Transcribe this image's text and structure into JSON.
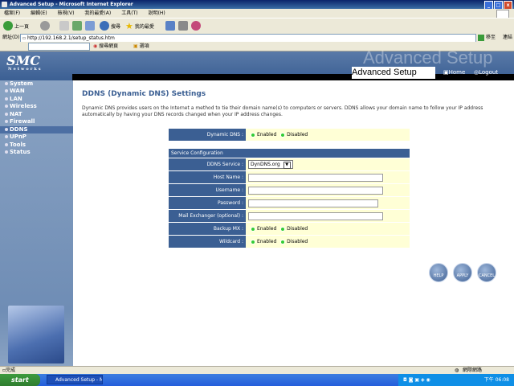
{
  "window": {
    "title": "Advanced Setup - Microsoft Internet Explorer"
  },
  "menu": [
    "檔案(F)",
    "編輯(E)",
    "檢視(V)",
    "我的最愛(A)",
    "工具(T)",
    "說明(H)"
  ],
  "toolbar": {
    "back_label": "上一頁",
    "search_label": "搜尋",
    "favorites_label": "我的最愛"
  },
  "address": {
    "label": "網址(D)",
    "url": "http://192.168.2.1/setup_status.htm",
    "go_label": "移至",
    "links_label": "連結"
  },
  "linkbar": {
    "search_web": "搜尋網頁",
    "options": "選項"
  },
  "brand": {
    "logo": "SMC",
    "logo_sub": "Networks",
    "watermark": "Advanced Setup",
    "section": "Advanced Setup"
  },
  "header_nav": {
    "home": "Home",
    "logout": "Logout"
  },
  "sidebar": {
    "items": [
      "System",
      "WAN",
      "LAN",
      "Wireless",
      "NAT",
      "Firewall",
      "DDNS",
      "UPnP",
      "Tools",
      "Status"
    ],
    "selected": "DDNS"
  },
  "page": {
    "title": "DDNS (Dynamic DNS) Settings",
    "description": "Dynamic DNS provides users on the Internet a method to tie their domain name(s) to computers or servers. DDNS allows your domain name to follow your IP address automatically by having your DNS records changed when your IP address changes."
  },
  "form": {
    "dynamic_dns": {
      "label": "Dynamic DNS :",
      "enabled": "Enabled",
      "disabled": "Disabled"
    },
    "section_header": "Service Configuration",
    "ddns_service": {
      "label": "DDNS Service :",
      "value": "DynDNS.org"
    },
    "host_name": {
      "label": "Host Name :",
      "value": ""
    },
    "username": {
      "label": "Username :",
      "value": ""
    },
    "password": {
      "label": "Password :",
      "value": ""
    },
    "mail_exchanger": {
      "label": "Mail Exchanger (optional) :",
      "value": ""
    },
    "backup_mx": {
      "label": "Backup MX :",
      "enabled": "Enabled",
      "disabled": "Disabled"
    },
    "wildcard": {
      "label": "Wildcard :",
      "enabled": "Enabled",
      "disabled": "Disabled"
    }
  },
  "actions": {
    "help": "HELP",
    "apply": "APPLY",
    "cancel": "CANCEL"
  },
  "statusbar": {
    "left": "完成",
    "zone": "網際網路"
  },
  "taskbar": {
    "start": "start",
    "task": "Advanced Setup - Mi...",
    "clock": "下午 06:08"
  }
}
